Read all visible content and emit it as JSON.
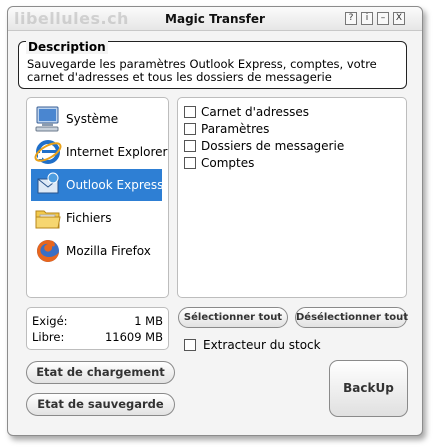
{
  "watermark": "libellules.ch",
  "window": {
    "title": "Magic Transfer"
  },
  "titlebar_buttons": {
    "help": "?",
    "info": "i",
    "minimize": "–",
    "close": "X"
  },
  "description": {
    "title": "Description",
    "text": "Sauvegarde les paramètres Outlook Express, comptes, votre carnet d'adresses et tous les dossiers de messagerie"
  },
  "sources": [
    {
      "label": "Système",
      "icon": "computer-icon",
      "selected": false
    },
    {
      "label": "Internet Explorer",
      "icon": "internet-explorer-icon",
      "selected": false
    },
    {
      "label": "Outlook Express",
      "icon": "outlook-express-icon",
      "selected": true
    },
    {
      "label": "Fichiers",
      "icon": "folder-icon",
      "selected": false
    },
    {
      "label": "Mozilla Firefox",
      "icon": "firefox-icon",
      "selected": false
    }
  ],
  "options": [
    {
      "label": "Carnet d'adresses",
      "checked": false
    },
    {
      "label": "Paramètres",
      "checked": false
    },
    {
      "label": "Dossiers de messagerie",
      "checked": false
    },
    {
      "label": "Comptes",
      "checked": false
    }
  ],
  "size": {
    "required_label": "Exigé:",
    "required_value": "1 MB",
    "free_label": "Libre:",
    "free_value": "11609 MB"
  },
  "buttons": {
    "select_all": "Sélectionner tout",
    "deselect_all": "Désélectionner tout",
    "load_state": "Etat de chargement",
    "save_state": "Etat de sauvegarde",
    "backup": "BackUp"
  },
  "stock_extractor": {
    "label": "Extracteur du stock",
    "checked": false
  },
  "colors": {
    "selection": "#2e7fd4",
    "window_bg": "#f4f4f4"
  }
}
